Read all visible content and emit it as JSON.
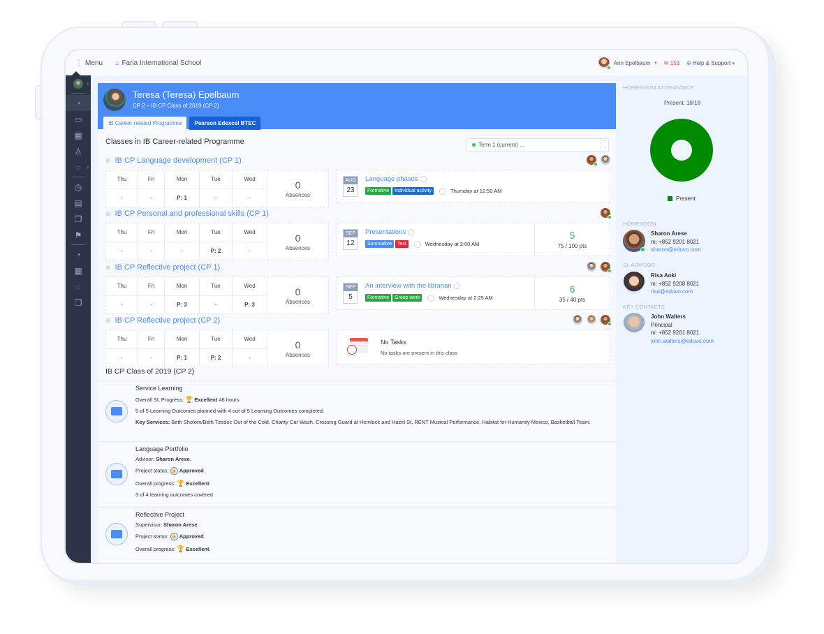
{
  "topbar": {
    "menu_label": "Menu",
    "school_name": "Faria International School",
    "user_name": "Ann Epelbaum",
    "mail_count": "153",
    "help_label": "Help & Support"
  },
  "sidenav": {
    "items": [
      "student-avatar",
      "dashboard-icon",
      "briefcase-icon",
      "calendar-icon",
      "user-icon",
      "chat-icon",
      "clock-icon",
      "schedule-icon",
      "documents-icon",
      "flag-icon",
      "dashboard-icon",
      "calendar-icon",
      "chat-icon",
      "documents-icon"
    ]
  },
  "student": {
    "name": "Teresa (Teresa) Epelbaum",
    "subtitle": "CP 2 – IB CP Class of 2019 (CP 2)",
    "tabs": [
      {
        "label": "IB Career-related Programme",
        "active": true
      },
      {
        "label": "Pearson Edexcel BTEC",
        "active": false
      }
    ]
  },
  "classes_section": {
    "title": "Classes in IB Career-related Programme",
    "term_select": "Term 1 (current) ...",
    "days": [
      "Thu",
      "Fri",
      "Mon",
      "Tue",
      "Wed"
    ],
    "absences_label": "Absences",
    "classes": [
      {
        "name": "IB CP Language development (CP 1)",
        "periods": [
          "-",
          "-",
          "P: 1",
          "-",
          "-"
        ],
        "absences": "0",
        "task": {
          "month": "AUG",
          "day": "23",
          "name": "Language phases",
          "tags": [
            {
              "label": "Formative",
              "color": "green"
            },
            {
              "label": "Individual activity",
              "color": "blue"
            }
          ],
          "due": "Thursday at 12:50 AM"
        },
        "grade": null
      },
      {
        "name": "IB CP Personal and professional skills (CP 1)",
        "periods": [
          "-",
          "-",
          "-",
          "P: 2",
          "-"
        ],
        "absences": "0",
        "task": {
          "month": "SEP",
          "day": "12",
          "name": "Presentations",
          "tags": [
            {
              "label": "Summative",
              "color": "sblue"
            },
            {
              "label": "Test",
              "color": "red"
            }
          ],
          "due": "Wednesday at 2:00 AM"
        },
        "grade": {
          "value": "5",
          "points": "75 / 100 pts"
        }
      },
      {
        "name": "IB CP Reflective project (CP 1)",
        "periods": [
          "-",
          "-",
          "P: 3",
          "-",
          "P: 3"
        ],
        "absences": "0",
        "task": {
          "month": "SEP",
          "day": "5",
          "name": "An interview with the librarian",
          "tags": [
            {
              "label": "Formative",
              "color": "green"
            },
            {
              "label": "Group work",
              "color": "green"
            }
          ],
          "due": "Wednesday at 2:25 AM"
        },
        "grade": {
          "value": "6",
          "points": "35 / 40 pts"
        }
      },
      {
        "name": "IB CP Reflective project (CP 2)",
        "periods": [
          "-",
          "-",
          "P: 1",
          "P: 2",
          "-"
        ],
        "absences": "0",
        "no_tasks": {
          "title": "No Tasks",
          "subtitle": "No tasks are present in this class"
        }
      }
    ]
  },
  "class_group": {
    "title": "IB CP Class of 2019 (CP 2)",
    "service_learning": {
      "title": "Service Learning",
      "progress_label": "Overall SL Progress:",
      "progress_value": "Excellent",
      "hours": "46 hours",
      "outcomes": "5 of 5 Learning Outcomes planned with 4 out of 5 Learning Outcomes completed.",
      "key_services_label": "Key Services:",
      "key_services": "Beth Sholom/Beth Tzedec Out of the Cold, Charity Car Wash, Crossing Guard at Hemlock and Hazel St, RENT Musical Performance, Habitat for Humanity Mexico, Basketball Team."
    },
    "language_portfolio": {
      "title": "Language Portfolio",
      "advisor_label": "Advisor:",
      "advisor": "Sharon Arese",
      "status_label": "Project status:",
      "status": "Approved",
      "progress_label": "Overall progress:",
      "progress": "Excellent",
      "outcomes": "3 of 4 learning outcomes covered"
    },
    "reflective_project": {
      "title": "Reflective Project",
      "supervisor_label": "Supervisor:",
      "supervisor": "Sharon Arese",
      "status_label": "Project status:",
      "status": "Approved",
      "progress_label": "Overall progress:",
      "progress": "Excellent"
    }
  },
  "right_panel": {
    "attendance_label": "HOMEROOM ATTENDANCE",
    "present_text": "Present: 18/18",
    "attendance": {
      "present": 18,
      "total": 18,
      "color": "#008a00"
    },
    "legend_label": "Present",
    "homeroom_label": "HOMEROOM",
    "homeroom": {
      "name": "Sharon Arese",
      "phone": "m: +852 9201 8021",
      "email": "sharon@eduvo.com"
    },
    "sl_advisor_label": "SL ADVISOR",
    "sl_advisor": {
      "name": "Risa Aoki",
      "phone": "m: +852 9208 8021",
      "email": "risa@eduvo.com"
    },
    "key_contacts_label": "KEY CONTACTS",
    "key_contact": {
      "name": "John Walters",
      "role": "Principal",
      "phone": "m: +852 9201 8021",
      "email": "john.walters@eduvo.com"
    }
  }
}
